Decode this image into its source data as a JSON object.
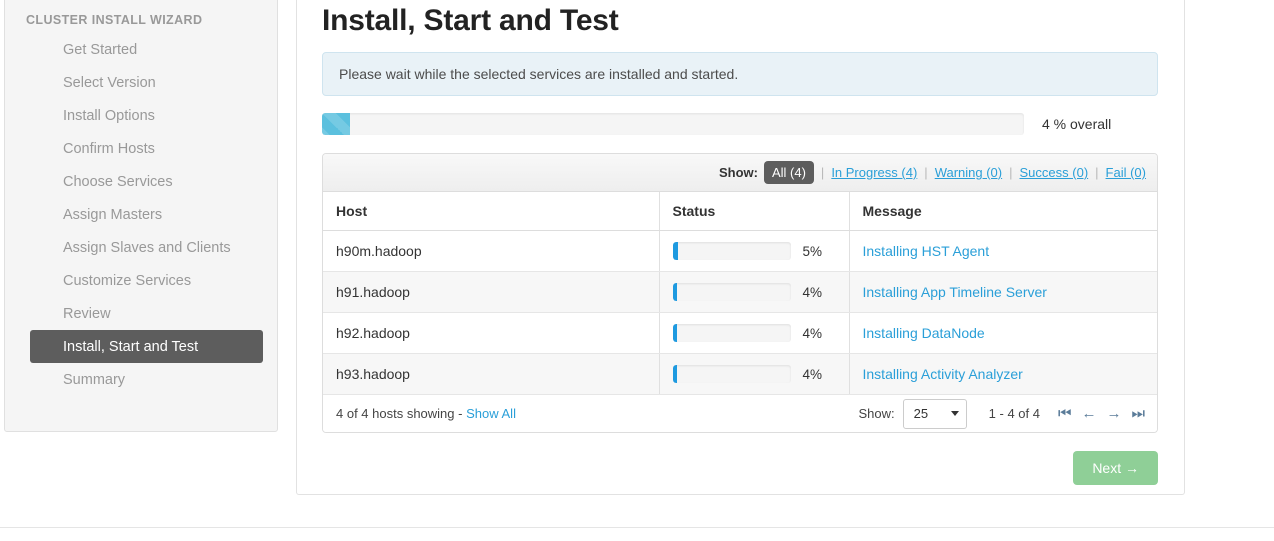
{
  "sidebar": {
    "title": "CLUSTER INSTALL WIZARD",
    "items": [
      {
        "label": "Get Started",
        "active": false
      },
      {
        "label": "Select Version",
        "active": false
      },
      {
        "label": "Install Options",
        "active": false
      },
      {
        "label": "Confirm Hosts",
        "active": false
      },
      {
        "label": "Choose Services",
        "active": false
      },
      {
        "label": "Assign Masters",
        "active": false
      },
      {
        "label": "Assign Slaves and Clients",
        "active": false
      },
      {
        "label": "Customize Services",
        "active": false
      },
      {
        "label": "Review",
        "active": false
      },
      {
        "label": "Install, Start and Test",
        "active": true
      },
      {
        "label": "Summary",
        "active": false
      }
    ]
  },
  "main": {
    "title": "Install, Start and Test",
    "info_message": "Please wait while the selected services are installed and started.",
    "overall_progress": {
      "percent": 4,
      "label": "4 % overall"
    },
    "filter": {
      "label": "Show:",
      "separator": "|",
      "options": [
        {
          "label": "All (4)",
          "active": true
        },
        {
          "label": "In Progress (4)",
          "active": false
        },
        {
          "label": "Warning (0)",
          "active": false
        },
        {
          "label": "Success (0)",
          "active": false
        },
        {
          "label": "Fail (0)",
          "active": false
        }
      ]
    },
    "table": {
      "columns": [
        "Host",
        "Status",
        "Message"
      ],
      "rows": [
        {
          "host": "h90m.hadoop",
          "percent": 5,
          "percent_label": "5%",
          "message": "Installing HST Agent"
        },
        {
          "host": "h91.hadoop",
          "percent": 4,
          "percent_label": "4%",
          "message": "Installing App Timeline Server"
        },
        {
          "host": "h92.hadoop",
          "percent": 4,
          "percent_label": "4%",
          "message": "Installing DataNode"
        },
        {
          "host": "h93.hadoop",
          "percent": 4,
          "percent_label": "4%",
          "message": "Installing Activity Analyzer"
        }
      ]
    },
    "footer": {
      "summary": "4 of 4 hosts showing -",
      "show_all": "Show All",
      "show_label": "Show:",
      "page_size": "25",
      "range": "1 - 4 of 4",
      "pager": {
        "first": "⏮",
        "prev": "←",
        "next": "→",
        "last": "⏭"
      }
    },
    "next_button": "Next →"
  },
  "colors": {
    "accent_link": "#2a9fd8",
    "progress_overall": "#5bc0de",
    "progress_row": "#1e9ae0",
    "active_item": "#5d5d5d",
    "next_button": "#8fcf97"
  }
}
